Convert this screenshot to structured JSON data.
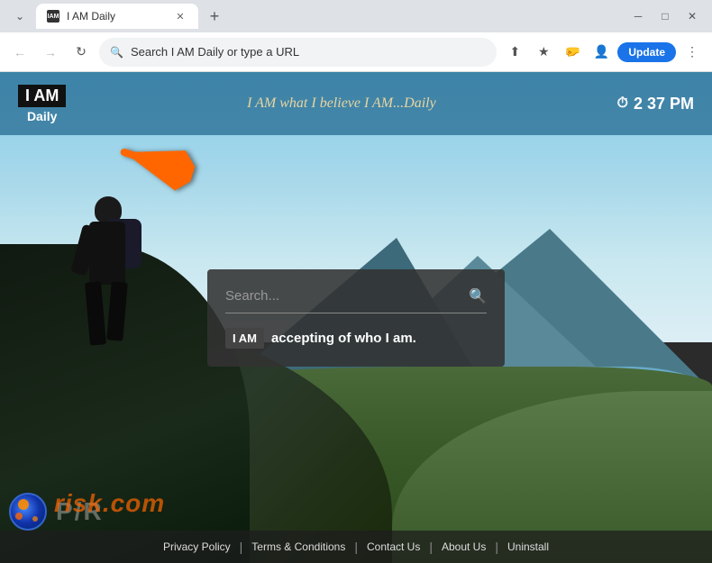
{
  "browser": {
    "tab_title": "I AM Daily",
    "tab_favicon": "IAM",
    "address": "Search I AM Daily or type a URL",
    "window_minimize": "─",
    "window_maximize": "□",
    "window_close": "✕",
    "update_btn": "Update",
    "new_tab": "+"
  },
  "site": {
    "logo_i": "I",
    "logo_am": "AM",
    "logo_daily": "Daily",
    "tagline": "I AM what I believe I AM...Daily",
    "clock_icon": "⏱",
    "clock_time": "2  37 PM",
    "search_placeholder": "Search...",
    "iam_badge": "I AM",
    "affirmation": "accepting of who I am.",
    "footer_links": [
      {
        "label": "Privacy Policy"
      },
      {
        "label": "Terms & Conditions"
      },
      {
        "label": "Contact Us"
      },
      {
        "label": "About Us"
      },
      {
        "label": "Uninstall"
      }
    ]
  },
  "arrow": "▲"
}
